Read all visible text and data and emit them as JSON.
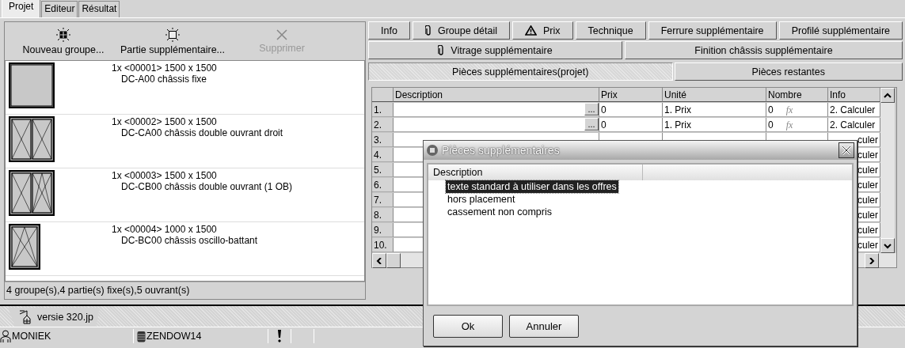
{
  "tabs": [
    {
      "label": "Projet",
      "selected": true
    },
    {
      "label": "Editeur",
      "selected": false
    },
    {
      "label": "Résultat",
      "selected": false
    }
  ],
  "toolbar": [
    {
      "kind": "group",
      "label": "Nouveau groupe...",
      "disabled": false
    },
    {
      "kind": "part",
      "label": "Partie supplémentaire...",
      "disabled": false
    },
    {
      "kind": "delete",
      "label": "Supprimer",
      "disabled": true
    }
  ],
  "items": [
    {
      "kind": "fixed",
      "line1": "1x <00001> 1500 x 1500",
      "line2": "DC-A00 châssis fixe"
    },
    {
      "kind": "double",
      "line1": "1x <00002> 1500 x 1500",
      "line2": "DC-CA00 châssis double ouvrant droit"
    },
    {
      "kind": "double_tilt",
      "line1": "1x <00003> 1500 x 1500",
      "line2": "DC-CB00 châssis double ouvrant (1 OB)"
    },
    {
      "kind": "tilt",
      "line1": "1x <00004> 1000 x 1500",
      "line2": "DC-BC00 châssis oscillo-battant"
    }
  ],
  "summary": "4 groupe(s),4 partie(s) fixe(s),5 ouvrant(s)",
  "document_tab": "versie 320.jp",
  "status_bar": {
    "user": "MONIEK",
    "database": "ZENDOW14"
  },
  "button_rows": [
    [
      {
        "label": "Info",
        "kind": "plain"
      },
      {
        "label": "Groupe détail",
        "kind": "attachment"
      },
      {
        "label": "Prix",
        "kind": "warning"
      },
      {
        "label": "Technique",
        "kind": "plain"
      },
      {
        "label": "Ferrure supplémentaire",
        "kind": "plain"
      },
      {
        "label": "Profilé supplémentaire",
        "kind": "plain"
      }
    ],
    [
      {
        "label": "Vitrage supplémentaire",
        "kind": "attachment"
      },
      {
        "label": "Finition châssis supplémentaire",
        "kind": "plain"
      }
    ]
  ],
  "subtabs": [
    {
      "label": "Pièces supplémentaires(projet)",
      "selected": true
    },
    {
      "label": "Pièces restantes",
      "selected": false
    }
  ],
  "table": {
    "columns": [
      "Description",
      "Prix",
      "Unité",
      "Nombre",
      "Info"
    ],
    "rows": [
      {
        "number": "1.",
        "ellipsis": "...",
        "prix": "0",
        "unite": "1. Prix",
        "nombre": "0",
        "fx": "fx",
        "info": "2. Calculer"
      },
      {
        "number": "2.",
        "ellipsis": "...",
        "prix": "0",
        "unite": "1. Prix",
        "nombre": "0",
        "fx": "fx",
        "info": "2. Calculer"
      },
      {
        "number": "3.",
        "info": "culer"
      },
      {
        "number": "4.",
        "info": "culer"
      },
      {
        "number": "5.",
        "info": "culer"
      },
      {
        "number": "6.",
        "info": "culer"
      },
      {
        "number": "7.",
        "info": "culer"
      },
      {
        "number": "8.",
        "info": "culer"
      },
      {
        "number": "9.",
        "info": "culer"
      },
      {
        "number": "10.",
        "info": "culer"
      }
    ]
  },
  "dialog": {
    "title": "Pièces supplémentaires",
    "column": "Description",
    "items": [
      {
        "label": "texte standard à utiliser dans les offres",
        "selected": true
      },
      {
        "label": "hors placement",
        "selected": false
      },
      {
        "label": "cassement non compris",
        "selected": false
      }
    ],
    "buttons": [
      "Ok",
      "Annuler"
    ]
  }
}
